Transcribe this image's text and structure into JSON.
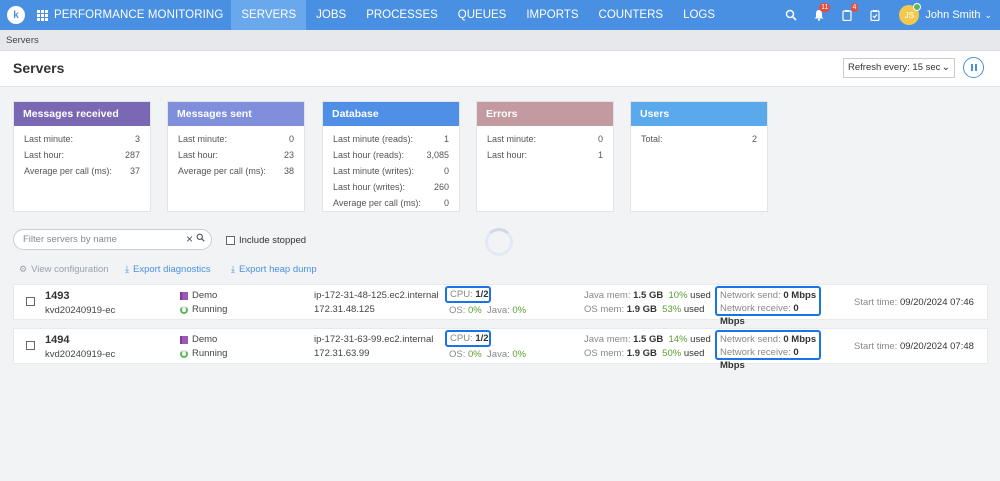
{
  "nav": {
    "logo": "k",
    "app_title": "PERFORMANCE MONITORING",
    "items": [
      "SERVERS",
      "JOBS",
      "PROCESSES",
      "QUEUES",
      "IMPORTS",
      "COUNTERS",
      "LOGS"
    ],
    "active": "SERVERS",
    "notifications_count": "11",
    "tasks_count": "4",
    "user_initials": "JS",
    "user_name": "John Smith"
  },
  "breadcrumb": "Servers",
  "header": {
    "title": "Servers",
    "refresh_label": "Refresh every: 15 sec"
  },
  "cards": {
    "received": {
      "title": "Messages received",
      "color": "#7b68b5",
      "rows": [
        [
          "Last minute:",
          "3"
        ],
        [
          "Last hour:",
          "287"
        ],
        [
          "Average per call (ms):",
          "37"
        ]
      ]
    },
    "sent": {
      "title": "Messages sent",
      "color": "#7f8fdc",
      "rows": [
        [
          "Last minute:",
          "0"
        ],
        [
          "Last hour:",
          "23"
        ],
        [
          "Average per call (ms):",
          "38"
        ]
      ]
    },
    "database": {
      "title": "Database",
      "color": "#4f8fe6",
      "rows": [
        [
          "Last minute (reads):",
          "1"
        ],
        [
          "Last hour (reads):",
          "3,085"
        ],
        [
          "Last minute (writes):",
          "0"
        ],
        [
          "Last hour (writes):",
          "260"
        ],
        [
          "Average per call (ms):",
          "0"
        ]
      ]
    },
    "errors": {
      "title": "Errors",
      "color": "#c39a9f",
      "rows": [
        [
          "Last minute:",
          "0"
        ],
        [
          "Last hour:",
          "1"
        ]
      ]
    },
    "users": {
      "title": "Users",
      "color": "#5aa9ec",
      "rows": [
        [
          "Total:",
          "2"
        ]
      ]
    }
  },
  "filter": {
    "placeholder": "Filter servers by name",
    "include_stopped": "Include stopped"
  },
  "actions": {
    "view_config": "View configuration",
    "export_diag": "Export diagnostics",
    "export_heap": "Export heap dump"
  },
  "labels": {
    "cpu": "CPU:",
    "os": "OS:",
    "java": "Java:",
    "java_mem": "Java mem:",
    "os_mem": "OS mem:",
    "used": "used",
    "net_send": "Network send:",
    "net_receive": "Network receive:",
    "start_time": "Start time:"
  },
  "servers": [
    {
      "id": "1493",
      "name": "kvd20240919-ec",
      "app": "Demo",
      "status": "Running",
      "host": "ip-172-31-48-125.ec2.internal",
      "ip": "172.31.48.125",
      "cpu": "1/2",
      "os_pct": "0%",
      "java_pct": "0%",
      "java_mem": "1.5 GB",
      "java_mem_pct": "10%",
      "os_mem": "1.9 GB",
      "os_mem_pct": "53%",
      "net_send": "0 Mbps",
      "net_receive": "0 Mbps",
      "start_time": "09/20/2024 07:46"
    },
    {
      "id": "1494",
      "name": "kvd20240919-ec",
      "app": "Demo",
      "status": "Running",
      "host": "ip-172-31-63-99.ec2.internal",
      "ip": "172.31.63.99",
      "cpu": "1/2",
      "os_pct": "0%",
      "java_pct": "0%",
      "java_mem": "1.5 GB",
      "java_mem_pct": "14%",
      "os_mem": "1.9 GB",
      "os_mem_pct": "50%",
      "net_send": "0 Mbps",
      "net_receive": "0 Mbps",
      "start_time": "09/20/2024 07:48"
    }
  ]
}
